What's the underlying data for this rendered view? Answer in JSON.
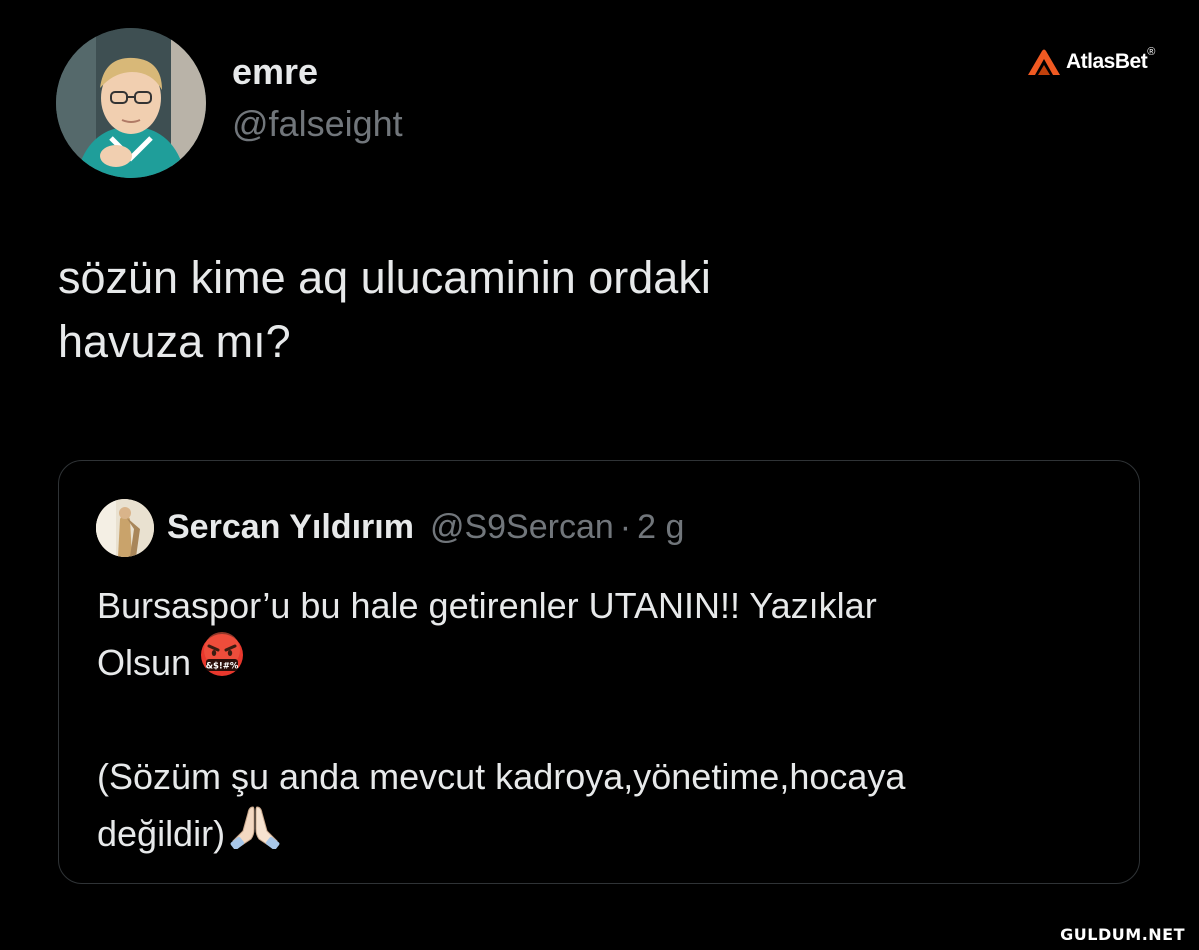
{
  "tweet": {
    "author": {
      "name": "emre",
      "handle": "@falseight"
    },
    "text_lines": [
      "sözün kime aq ulucaminin ordaki",
      "havuza mı?"
    ],
    "quoted": {
      "author_name": "Sercan Yıldırım",
      "author_handle": "@S9Sercan",
      "separator": "·",
      "time": "2 g",
      "body_lines": [
        "Bursaspor’u bu hale getirenler UTANIN!! Yazıklar",
        "Olsun",
        "",
        "(Sözüm şu anda mevcut kadroya,yönetime,hocaya",
        "değildir)"
      ],
      "emojis": [
        "face-with-symbols-on-mouth-icon",
        "folded-hands-icon"
      ]
    }
  },
  "brand": {
    "text": "AtlasBet",
    "registered": "®",
    "accent_color": "#f05a22"
  },
  "watermark": "GULDUM.NET",
  "colors": {
    "background": "#000000",
    "primary_text": "#e7e9ea",
    "secondary_text": "#71767b",
    "card_border": "#2f3336"
  }
}
